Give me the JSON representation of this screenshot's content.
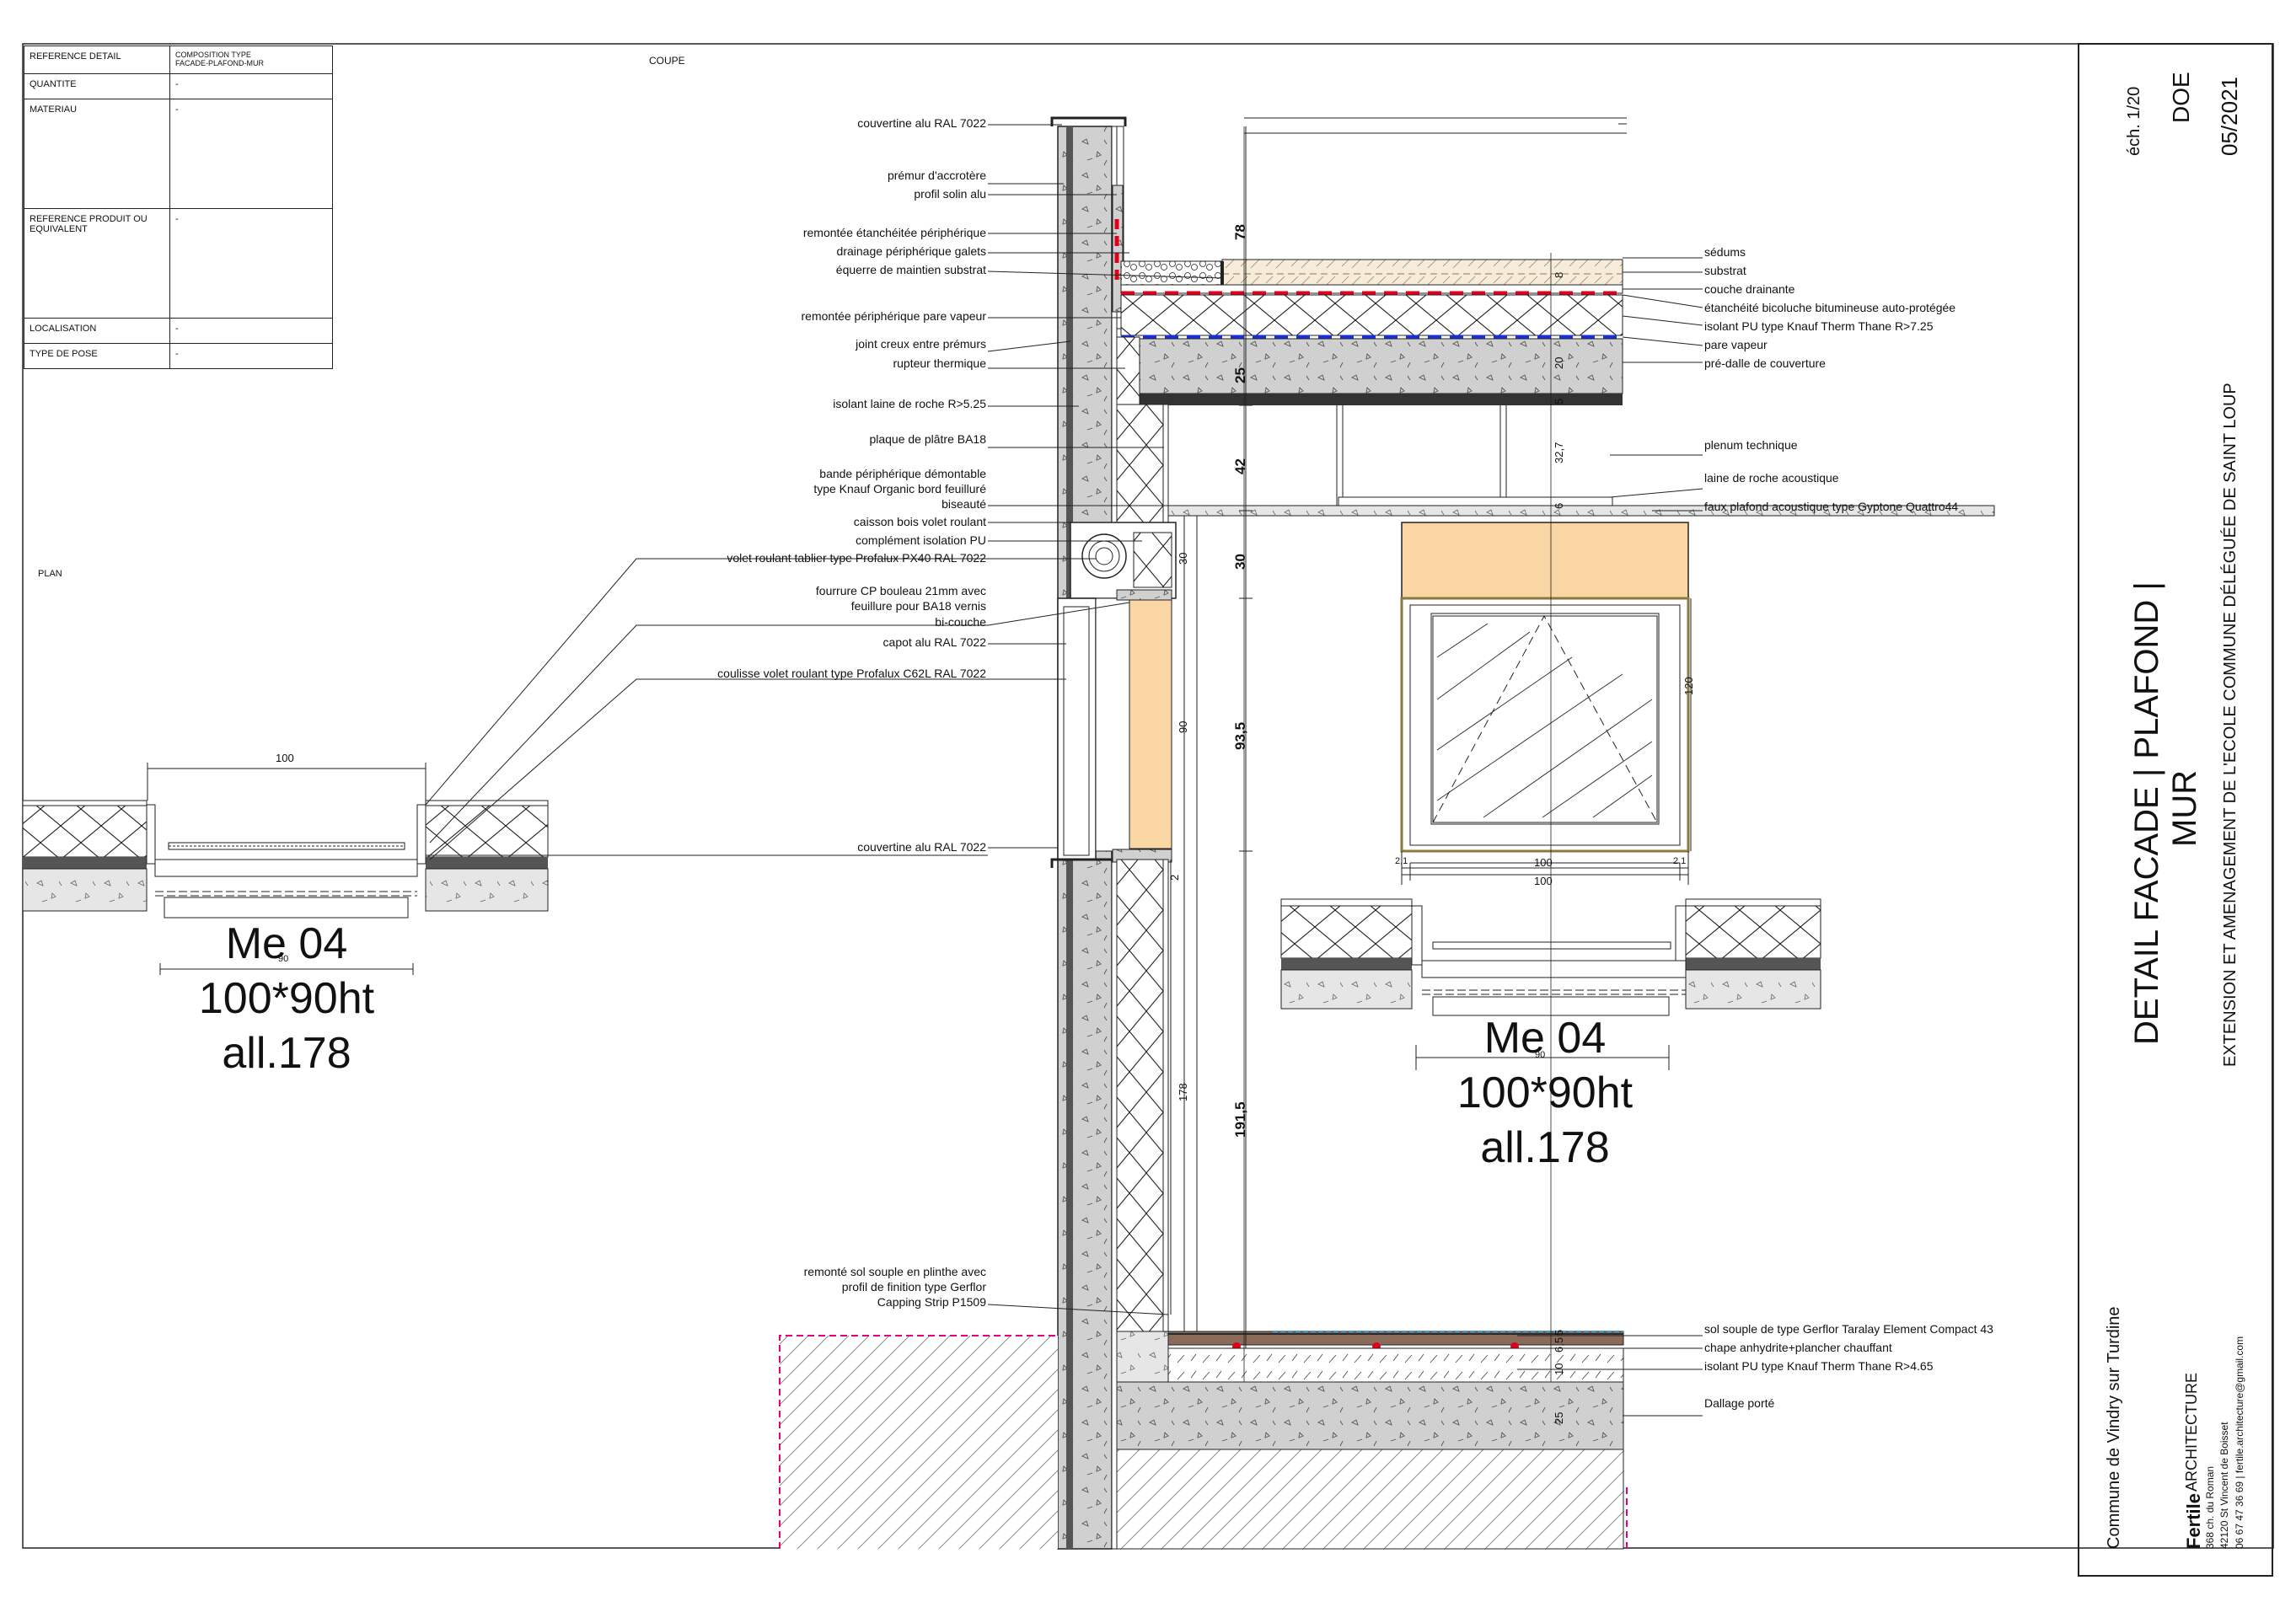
{
  "info_table": {
    "rows": [
      {
        "label": "REFERENCE DETAIL",
        "value": "COMPOSITION TYPE\nFACADE-PLAFOND-MUR"
      },
      {
        "label": "QUANTITE",
        "value": "-"
      },
      {
        "label": "MATERIAU",
        "value": "-"
      },
      {
        "label": "REFERENCE PRODUIT OU EQUIVALENT",
        "value": "-"
      },
      {
        "label": "LOCALISATION",
        "value": "-"
      },
      {
        "label": "TYPE DE POSE",
        "value": "-"
      }
    ]
  },
  "section_labels": {
    "coupe": "COUPE",
    "plan": "PLAN"
  },
  "left_labels": [
    "couvertine alu RAL 7022",
    "prémur d'accrotère",
    "profil solin alu",
    "remontée étanchéitée périphérique",
    "drainage périphérique galets",
    "équerre de maintien substrat",
    "remontée périphérique pare vapeur",
    "joint creux entre prémurs",
    "rupteur thermique",
    "isolant laine de roche R>5.25",
    "plaque de plâtre BA18",
    "bande périphérique démontable",
    "type Knauf Organic bord feuilluré",
    "biseauté",
    "caisson bois volet roulant",
    "complément isolation PU",
    "volet roulant tablier type Profalux PX40 RAL 7022",
    "fourrure CP bouleau 21mm avec",
    "feuillure pour BA18 vernis",
    "bi-couche",
    "capot alu RAL 7022",
    "coulisse volet roulant type Profalux C62L RAL 7022",
    "couvertine alu RAL 7022",
    "remonté sol souple en plinthe avec",
    "profil de finition type Gerflor",
    "Capping Strip P1509"
  ],
  "right_labels": [
    "sédums",
    "substrat",
    "couche drainante",
    "étanchéité bicoluche bitumineuse auto-protégée",
    "isolant PU type Knauf Therm Thane R>7.25",
    "pare vapeur",
    "pré-dalle de couverture",
    "plenum technique",
    "laine de roche acoustique",
    "faux plafond acoustique type Gyptone Quattro44",
    "sol souple de type Gerflor Taralay Element Compact 43",
    "chape anhydrite+plancher chauffant",
    "isolant PU type Knauf Therm Thane R>4.65",
    "Dallage porté"
  ],
  "dimensions": {
    "d78": "78",
    "d25": "25",
    "d42": "42",
    "d30": "30",
    "d93": "93,5",
    "d191": "191,5",
    "d8": "8",
    "d20": "20",
    "d5": "5",
    "d327": "32,7",
    "d6": "6",
    "d30s": "30",
    "d90s": "90",
    "d178s": "178",
    "d2": "2",
    "d5b": "5",
    "d65": "6,5",
    "d10": "10",
    "d25b": "25",
    "d120": "120",
    "plan_w": "100",
    "plan_90": "90",
    "elev_100a": "100",
    "elev_100b": "100",
    "elev_21a": "2,1",
    "elev_21b": "2,1",
    "elev_90": "90"
  },
  "window_mark_left": {
    "ref": "Me 04",
    "size": "100*90ht",
    "alt": "all.178"
  },
  "window_mark_right": {
    "ref": "Me 04",
    "size": "100*90ht",
    "alt": "all.178"
  },
  "cartouche": {
    "scale": "éch. 1/20",
    "phase": "DOE",
    "date": "05/2021",
    "title": "DETAIL FACADE | PLAFOND | MUR",
    "title_line1": "DETAIL FACADE | PLAFOND |",
    "title_line2": "MUR",
    "project": "EXTENSION ET AMENAGEMENT DE L'ECOLE COMMUNE DÉLÉGUÉE DE SAINT LOUP",
    "client": "Commune de Vindry sur Turdine",
    "firm_name": "Fertile",
    "firm_type": "ARCHITECTURE",
    "firm_addr1": "368 ch. du Roman",
    "firm_addr2": "42120 St Vincent de Boisset",
    "firm_contact": "06 67 47 36 69 | fertile.architecture@gmail.com"
  },
  "colors": {
    "orange": "#fad6a5",
    "red": "#e0001a",
    "blue": "#1a2fd6",
    "dashed_pink": "#e6007e",
    "dark": "#333333",
    "concrete": "#d0d0d0"
  }
}
